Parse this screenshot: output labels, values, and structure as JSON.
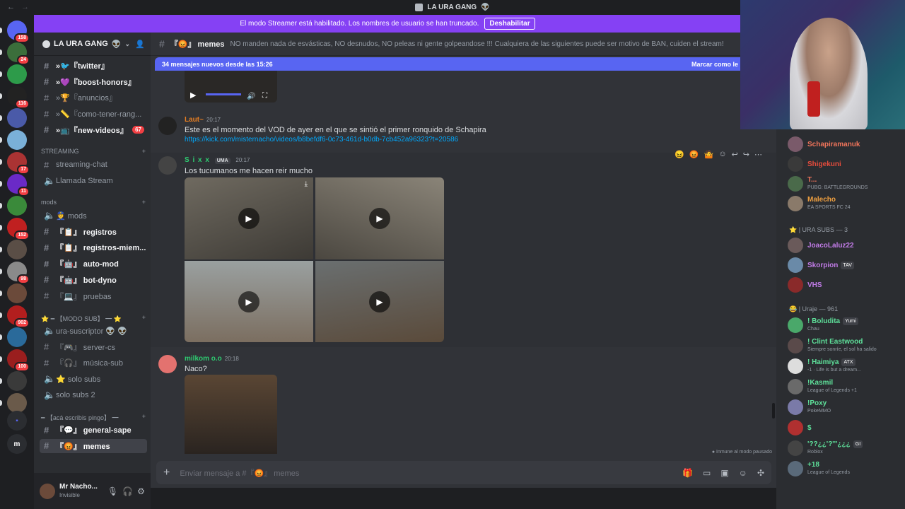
{
  "window": {
    "title": "LA URA GANG",
    "title_emoji": "👽"
  },
  "streamer_bar": {
    "text": "El modo Streamer está habilitado. Los nombres de usuario se han truncado.",
    "button": "Deshabilitar"
  },
  "servers": [
    {
      "badge": "158"
    },
    {
      "badge": "24"
    },
    {
      "badge": ""
    },
    {
      "badge": "116"
    },
    {
      "badge": ""
    },
    {
      "badge": ""
    },
    {
      "badge": "17"
    },
    {
      "badge": "11"
    },
    {
      "badge": ""
    },
    {
      "badge": "152"
    },
    {
      "badge": ""
    },
    {
      "badge": "98"
    },
    {
      "badge": ""
    },
    {
      "badge": "902"
    },
    {
      "badge": ""
    },
    {
      "badge": "100"
    },
    {
      "badge": ""
    },
    {
      "badge": ""
    }
  ],
  "server_letter": "m",
  "guild": {
    "name": "LA URA GANG",
    "emoji": "👽"
  },
  "channels": [
    {
      "label": "»🐦『twitter』",
      "type": "text",
      "unread": true
    },
    {
      "label": "»💜『boost-honors』",
      "type": "text",
      "unread": true
    },
    {
      "label": "»🏆『anuncios』",
      "type": "text",
      "unread": false
    },
    {
      "label": "»📏『como-tener-rang...",
      "type": "text",
      "unread": false
    },
    {
      "label": "»📺『new-videos』",
      "type": "text",
      "unread": true,
      "count": "67"
    }
  ],
  "cat_streaming": "STREAMING",
  "streaming_channels": [
    {
      "label": "streaming-chat",
      "type": "text"
    },
    {
      "label": "Llamada Stream",
      "type": "voice"
    }
  ],
  "cat_mods": "mods",
  "mods_channels": [
    {
      "label": "👮 mods",
      "type": "voice",
      "unread": false
    },
    {
      "label": "『📋』 registros",
      "type": "text",
      "unread": true
    },
    {
      "label": "『📋』 registros-miem...",
      "type": "text",
      "unread": true
    },
    {
      "label": "『🤖』 auto-mod",
      "type": "text",
      "unread": true
    },
    {
      "label": "『🤖』 bot-dyno",
      "type": "text",
      "unread": true
    },
    {
      "label": "『💻』 pruebas",
      "type": "text",
      "unread": false
    }
  ],
  "cat_sub": "⭐ ━ 【MODO SUB】 ━ ⭐",
  "sub_channels": [
    {
      "label": "ura-suscriptor 👽 👽",
      "type": "voice"
    },
    {
      "label": "『🎮』 server-cs",
      "type": "text"
    },
    {
      "label": "『🎧』 música-sub",
      "type": "text"
    },
    {
      "label": "⭐ solo subs",
      "type": "voice"
    },
    {
      "label": "solo subs 2",
      "type": "voice"
    }
  ],
  "cat_write": "━ 【acá escribis pingo】 ━",
  "write_channels": [
    {
      "label": "『💬』 general-sape",
      "type": "text",
      "unread": true
    },
    {
      "label": "『😡』 memes",
      "type": "text",
      "selected": true
    }
  ],
  "user": {
    "name": "Mr Nacho...",
    "status": "Invisible"
  },
  "header": {
    "channel": "『😡』 memes",
    "topic": "NO manden nada de esvásticas, NO desnudos, NO peleas ni gente golpeandose !!! Cualquiera de las siguientes puede ser motivo de BAN, cuiden el stream!"
  },
  "new_messages": {
    "text": "34 mensajes nuevos desde las 15:26",
    "action": "Marcar como le"
  },
  "messages": [
    {
      "author": "Laut~",
      "time": "20:17",
      "text": "Este es el momento del VOD de ayer en el que se sintió el primer ronquido de Schapira",
      "link": "https://kick.com/misternacho/videos/b8befdf6-0c73-461d-b0db-7cb452a96323?t=20586",
      "color": "#e67e22"
    },
    {
      "author": "S i x x",
      "tag": "UMA",
      "time": "20:17",
      "text": "Los tucumanos me hacen reir mucho",
      "color": "#2ecc71"
    },
    {
      "author": "milkom o.o",
      "time": "20:18",
      "text": "Naco?",
      "color": "#2ecc71"
    }
  ],
  "immune": "Inmune al modo pausado",
  "composer": {
    "placeholder": "Enviar mensaje a #『😡』 memes"
  },
  "members_top": [
    {
      "name": "Schapiramanuk",
      "sub": "",
      "color": "#f0745a"
    },
    {
      "name": "Shigekuni",
      "sub": "",
      "color": "#e74c3c"
    },
    {
      "name": "T...",
      "sub": "PUBG: BATTLEGROUNDS",
      "color": "#f0745a"
    },
    {
      "name": "Malecho",
      "sub": "EA SPORTS FC 24",
      "color": "#f0a040"
    }
  ],
  "cat_urasubs": "⭐ | URA SUBS — 3",
  "members_subs": [
    {
      "name": "JoacoLaluz22",
      "sub": "",
      "color": "#c27ce8"
    },
    {
      "name": "Skorpion",
      "tag": "TAV",
      "sub": "",
      "color": "#c27ce8"
    },
    {
      "name": "VHS",
      "sub": "",
      "color": "#c27ce8"
    }
  ],
  "cat_urajes": "😂 | Uraje — 961",
  "members_urajes": [
    {
      "name": "! Boludita",
      "tag": "Yumi",
      "sub": "Chau",
      "color": "#5ee09a"
    },
    {
      "name": "! Clint Eastwood",
      "sub": "Siempre sonríe, el sol ha salido",
      "color": "#5ee09a"
    },
    {
      "name": "! Haimiya",
      "tag": "ATX",
      "sub": "-1 · Life is but a dream...",
      "color": "#5ee09a"
    },
    {
      "name": "!Kasmil",
      "sub": "League of Legends +1",
      "color": "#5ee09a"
    },
    {
      "name": "!Poxy",
      "sub": "PokeMMO",
      "color": "#5ee09a"
    },
    {
      "name": "$",
      "sub": "",
      "color": "#5ee09a"
    },
    {
      "name": "'??¿¿'?'''¿¿¿",
      "tag": "GI",
      "sub": "Roblox",
      "color": "#5ee09a"
    },
    {
      "name": "+18",
      "sub": "League of Legends",
      "color": "#5ee09a"
    }
  ],
  "colors": {
    "accent": "#5865f2",
    "streamer": "#8541f4",
    "danger": "#f23f43"
  }
}
